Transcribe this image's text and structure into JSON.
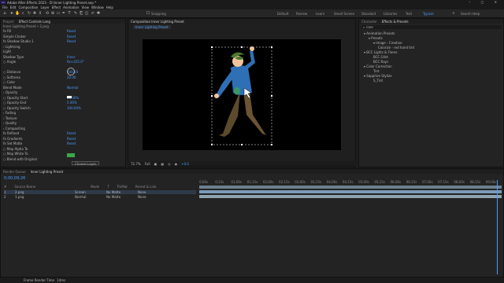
{
  "window": {
    "app_icon": "Ae",
    "title": "Adobe After Effects 2023 - D:\\Inner Lighting Preset.aep *",
    "controls": "–  ▢  ✕"
  },
  "menu": [
    "File",
    "Edit",
    "Composition",
    "Layer",
    "Effect",
    "Animation",
    "View",
    "Window",
    "Help"
  ],
  "toolbar": {
    "snapping_label": "Snapping",
    "workspaces": [
      "Default",
      "Review",
      "Learn",
      "Small Screen",
      "Standard",
      "Libraries",
      "Text",
      "Typical"
    ],
    "active_workspace": "Typical",
    "search_help_placeholder": "Search Help"
  },
  "effect_panel": {
    "tabs": [
      "Project",
      "Effect Controls Long"
    ],
    "header": "Inner Lighting Preset • 2.png",
    "lines": [
      {
        "text": "fx  Fill",
        "value": "Reset"
      },
      {
        "text": "     Simple Choker",
        "value": "Reset"
      },
      {
        "text": "fx  Shadow Studio 1",
        "value": "Reset"
      },
      {
        "text": "   › Lightning",
        "value": ""
      },
      {
        "text": "        Light",
        "value": ""
      },
      {
        "text": "        Shadow Type",
        "value": "Inner"
      },
      {
        "text": "     ○ Angle",
        "value": "0x+225.0°"
      },
      {
        "text": "",
        "value": ""
      },
      {
        "text": "     ○ Distance",
        "value": "100.00"
      },
      {
        "text": "     ○ Softness",
        "value": "20.00"
      },
      {
        "text": "     ○ Color",
        "value": ""
      },
      {
        "text": "        Blend Mode",
        "value": "Normal"
      },
      {
        "text": "   › Opacity",
        "value": ""
      },
      {
        "text": "     ○ Opacity Start",
        "value": "25.00%"
      },
      {
        "text": "     ○ Opacity End",
        "value": "5.00%"
      },
      {
        "text": "     ○ Opacity Switch",
        "value": "100.00%"
      },
      {
        "text": "   › Fading",
        "value": ""
      },
      {
        "text": "   › Texture",
        "value": ""
      },
      {
        "text": "   › Quality",
        "value": ""
      },
      {
        "text": "   › Compositing",
        "value": ""
      },
      {
        "text": "fx  Refined",
        "value": "Reset"
      },
      {
        "text": "fx  Gradients",
        "value": "Reset"
      },
      {
        "text": "fx  Set Matte",
        "value": "Reset"
      },
      {
        "text": "     ○ Map Alpha To",
        "value": ""
      },
      {
        "text": "     ○ Map White To",
        "value": ""
      },
      {
        "text": "     ○ Blend with Original",
        "value": ""
      }
    ],
    "green_button": "",
    "choose_button": "Choose Layer"
  },
  "comp_panel": {
    "tabs": [
      "Composition Inner Lighting Preset"
    ],
    "sub_tab": "Inner Lighting Preset",
    "viewer": {
      "zoom": "72.7%",
      "quality": "Full",
      "exposure": "+0.0"
    }
  },
  "right_panel": {
    "tabs": [
      "Character",
      "Effects & Presets"
    ],
    "search_value": "inne",
    "lines": [
      {
        "indent": 2,
        "text": "▾ Animation Presets"
      },
      {
        "indent": 6,
        "text": "▾ Presets"
      },
      {
        "indent": 10,
        "text": "▾ Image - Creative"
      },
      {
        "indent": 14,
        "text": "Colorize - red hand tint"
      },
      {
        "indent": 2,
        "text": "▾ BCC Lights & Flares"
      },
      {
        "indent": 10,
        "text": "BCC Glint"
      },
      {
        "indent": 10,
        "text": "BCC Rays"
      },
      {
        "indent": 2,
        "text": "▾ Color Correction"
      },
      {
        "indent": 10,
        "text": "Tint"
      },
      {
        "indent": 2,
        "text": "▾ Sapphire Stylize"
      },
      {
        "indent": 10,
        "text": "S_Tint"
      }
    ]
  },
  "timeline": {
    "tabs": [
      "Render Queue",
      "Inner Lighting Preset"
    ],
    "timecode": "0;00;09;26",
    "col_headers": [
      "#",
      "Source Name",
      "Mode",
      "T",
      "TrkMat",
      "Parent & Link"
    ],
    "layers": [
      {
        "num": "1",
        "name": "2.png",
        "mode": "Screen",
        "trkmat": "No Matte",
        "parent": "None"
      },
      {
        "num": "2",
        "name": "1.png",
        "mode": "Normal",
        "trkmat": "No Matte",
        "parent": "None"
      }
    ],
    "ruler": [
      "0;00s",
      "0;15s",
      "01;00s",
      "01;15s",
      "02;00s",
      "02;15s",
      "03;00s",
      "03;15s",
      "04;00s",
      "04;15s",
      "05;00s",
      "05;15s",
      "06;00s",
      "06;15s",
      "07;00s",
      "07;15s",
      "08;00s",
      "08;15s",
      "09;00s"
    ]
  },
  "status": {
    "label": "Frame Render Time",
    "value": "14ms"
  },
  "colors": {
    "accent": "#4b9bff",
    "layer_bar": "#8fa3b0",
    "selected_bar": "#7c9ab8"
  }
}
